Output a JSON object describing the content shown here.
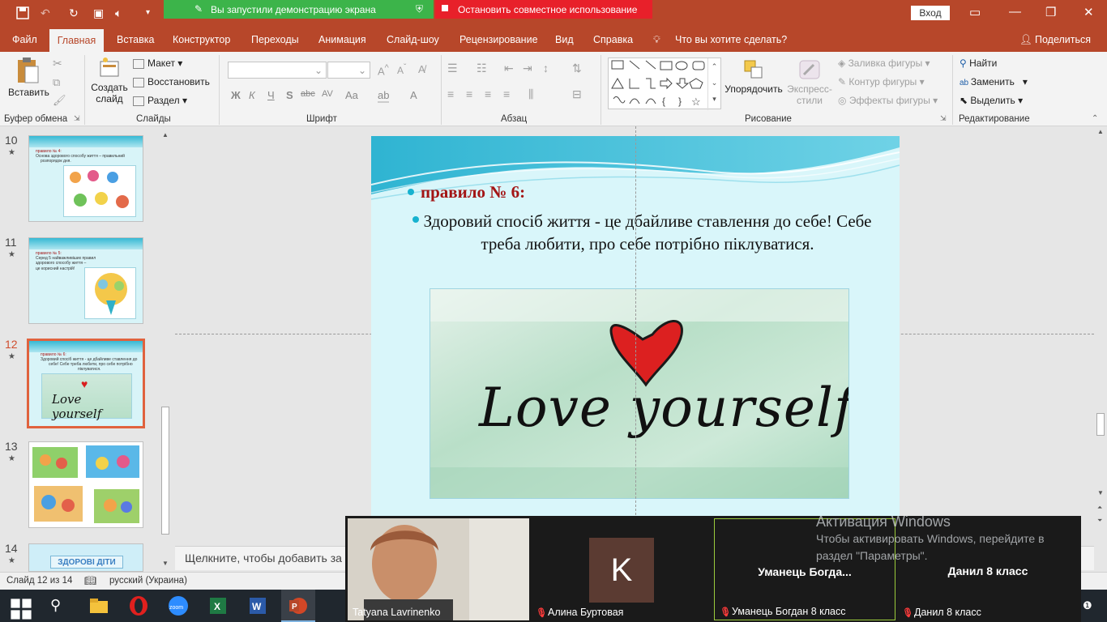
{
  "titlebar": {
    "share_banner": "Вы запустили демонстрацию экрана",
    "stop_share": "Остановить совместное использование",
    "signin": "Вход",
    "colors": {
      "brand": "#b7472a",
      "share": "#3cb44a",
      "stop": "#e8202a"
    }
  },
  "menu": {
    "items": [
      "Файл",
      "Главная",
      "Вставка",
      "Конструктор",
      "Переходы",
      "Анимация",
      "Слайд-шоу",
      "Рецензирование",
      "Вид",
      "Справка"
    ],
    "tell_me": "Что вы хотите сделать?",
    "share": "Поделиться"
  },
  "ribbon": {
    "clipboard": {
      "paste": "Вставить",
      "label": "Буфер обмена"
    },
    "slides": {
      "new_slide_1": "Создать",
      "new_slide_2": "слайд",
      "layout": "Макет",
      "reset": "Восстановить",
      "section": "Раздел",
      "label": "Слайды"
    },
    "font": {
      "label": "Шрифт",
      "bold": "Ж",
      "italic": "К",
      "underline": "Ч",
      "shadow": "S",
      "strike": "abc",
      "spacing": "AV",
      "case": "Aa",
      "color": "A"
    },
    "paragraph": {
      "label": "Абзац"
    },
    "drawing": {
      "arrange": "Упорядочить",
      "quick_styles_1": "Экспресс-",
      "quick_styles_2": "стили",
      "fill": "Заливка фигуры",
      "outline": "Контур фигуры",
      "effects": "Эффекты фигуры",
      "label": "Рисование"
    },
    "editing": {
      "find": "Найти",
      "replace": "Заменить",
      "select": "Выделить",
      "label": "Редактирование"
    }
  },
  "thumbnails": [
    {
      "num": "10",
      "lines": [
        "правило № 4:",
        "Основа здорового способу життя – правильний",
        "розпорядок дня."
      ]
    },
    {
      "num": "11",
      "lines": [
        "правило № 5:",
        "Серед 5 найважливіших правил",
        "здорового способу життя –",
        "це корисний настрій!"
      ]
    },
    {
      "num": "12",
      "lines": [
        "правило № 6:",
        "Здоровий спосіб життя - це дбайливе ставлення до",
        "себе! Себе треба любити, про себе потрібно",
        "піклуватися."
      ],
      "image_text": "Love yourself"
    },
    {
      "num": "13"
    },
    {
      "num": "14",
      "banner": "ЗДОРОВІ ДІТИ"
    }
  ],
  "slide": {
    "bullet1": "правило № 6:",
    "bullet2": "Здоровий спосіб життя - це дбайливе ставлення до себе! Себе треба любити, про себе потрібно піклуватися.",
    "image_text": "Love yourself"
  },
  "notes": {
    "placeholder": "Щелкните, чтобы добавить за"
  },
  "status": {
    "slide_info": "Слайд 12 из 14",
    "language": "русский (Украина)"
  },
  "video": {
    "tiles": [
      {
        "name": "Tatyana Lavrinenko"
      },
      {
        "name": "Алина Буртовая",
        "initial": "K",
        "avatar_color": "#5b3b32"
      },
      {
        "name": "Уманець Богдан 8 класс",
        "center": "Уманець  Богда..."
      },
      {
        "name": "Данил 8 класс",
        "center": "Данил 8 класс"
      }
    ]
  },
  "watermark": {
    "title": "Активация Windows",
    "line1": "Чтобы активировать Windows, перейдите в",
    "line2": "раздел \"Параметры\"."
  }
}
